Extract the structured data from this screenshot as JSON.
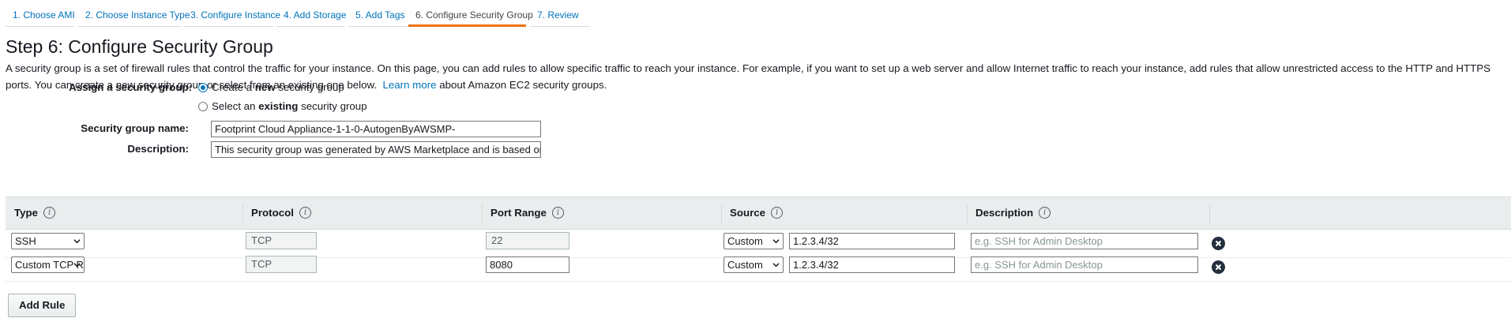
{
  "wizard": {
    "tabs": [
      {
        "label": "1. Choose AMI"
      },
      {
        "label": "2. Choose Instance Type"
      },
      {
        "label": "3. Configure Instance"
      },
      {
        "label": "4. Add Storage"
      },
      {
        "label": "5. Add Tags"
      },
      {
        "label": "6. Configure Security Group",
        "active": true
      },
      {
        "label": "7. Review"
      }
    ]
  },
  "page": {
    "title": "Step 6: Configure Security Group",
    "intro_text": "A security group is a set of firewall rules that control the traffic for your instance. On this page, you can add rules to allow specific traffic to reach your instance. For example, if you want to set up a web server and allow Internet traffic to reach your instance, add rules that allow unrestricted access to the HTTP and HTTPS ports. You can create a new security group or select from an existing one below.",
    "learn_more": "Learn more",
    "intro_suffix": "about Amazon EC2 security groups."
  },
  "form": {
    "assign_label": "Assign a security group:",
    "option_new": {
      "pre": "Create a ",
      "bold": "new",
      "post": " security group",
      "checked": true
    },
    "option_existing": {
      "pre": "Select an ",
      "bold": "existing",
      "post": " security group",
      "checked": false
    },
    "name_label": "Security group name:",
    "name_value": "Footprint Cloud Appliance-1-1-0-AutogenByAWSMP-",
    "description_label": "Description:",
    "description_value": "This security group was generated by AWS Marketplace and is based on recomm"
  },
  "table": {
    "headers": {
      "type": "Type",
      "protocol": "Protocol",
      "port_range": "Port Range",
      "source": "Source",
      "description": "Description"
    },
    "info_icon_glyph": "i",
    "rows": [
      {
        "type": "SSH",
        "protocol": "TCP",
        "port_range": "22",
        "source_mode": "Custom",
        "source_cidr": "1.2.3.4/32",
        "description_placeholder": "e.g. SSH for Admin Desktop"
      },
      {
        "type": "Custom TCP R",
        "protocol": "TCP",
        "port_range": "8080",
        "source_mode": "Custom",
        "source_cidr": "1.2.3.4/32",
        "description_placeholder": "e.g. SSH for Admin Desktop"
      }
    ]
  },
  "actions": {
    "add_rule": "Add Rule"
  },
  "icons": {
    "info": "info-icon",
    "delete": "remove-circle-icon",
    "dropdown": "chevron-down-icon"
  },
  "colors": {
    "link": "#0073bb",
    "active_tab_underline": "#ec7211",
    "table_header_bg": "#eaeded"
  }
}
